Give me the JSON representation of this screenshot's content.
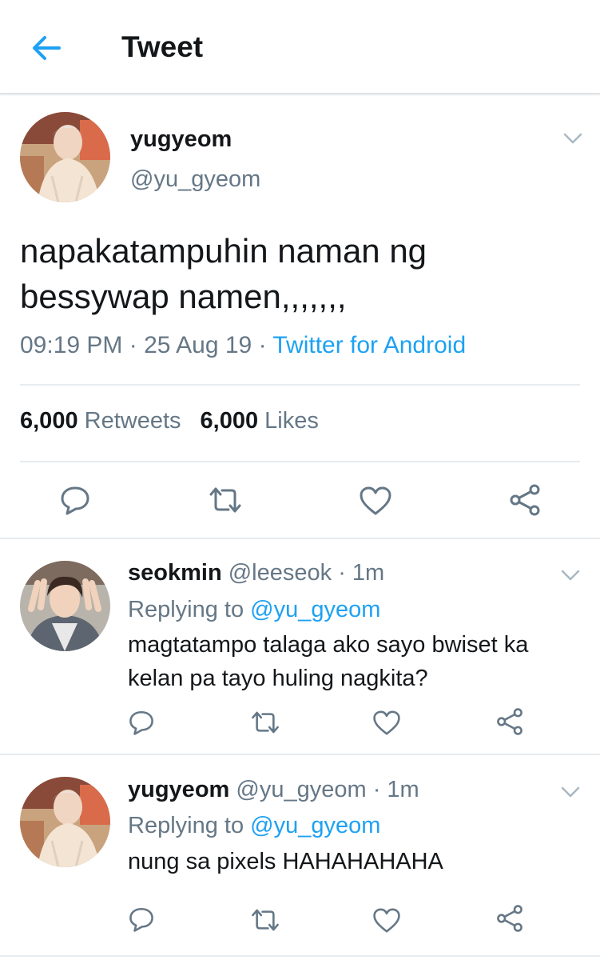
{
  "header": {
    "title": "Tweet",
    "back_icon": "arrow-left-icon",
    "accent": "#1da1f2"
  },
  "main_tweet": {
    "display_name": "yugyeom",
    "handle": "@yu_gyeom",
    "text_line1": "napakatampuhin naman ng",
    "text_line2": "bessywap namen,,,,,,,",
    "time": "09:19 PM",
    "date": "25 Aug 19",
    "source": "Twitter for Android",
    "retweet_count": "6,000",
    "retweet_label": "Retweets",
    "like_count": "6,000",
    "like_label": "Likes",
    "actions": [
      "reply-icon",
      "retweet-icon",
      "like-icon",
      "share-icon"
    ]
  },
  "replies": [
    {
      "display_name": "seokmin",
      "handle": "@leeseok",
      "time": "1m",
      "replying_prefix": "Replying to",
      "replying_handle": "@yu_gyeom",
      "text_line1": "magtatampo talaga ako sayo bwiset ka",
      "text_line2": "kelan pa tayo huling nagkita?"
    },
    {
      "display_name": "yugyeom",
      "handle": "@yu_gyeom",
      "time": "1m",
      "replying_prefix": "Replying to",
      "replying_handle": "@yu_gyeom",
      "text_line1": "nung sa pixels HAHAHAHAHA"
    }
  ],
  "separator": " · ",
  "colors": {
    "text": "#14171a",
    "secondary": "#657786",
    "link": "#1da1f2",
    "divider": "#e6ecf0"
  }
}
